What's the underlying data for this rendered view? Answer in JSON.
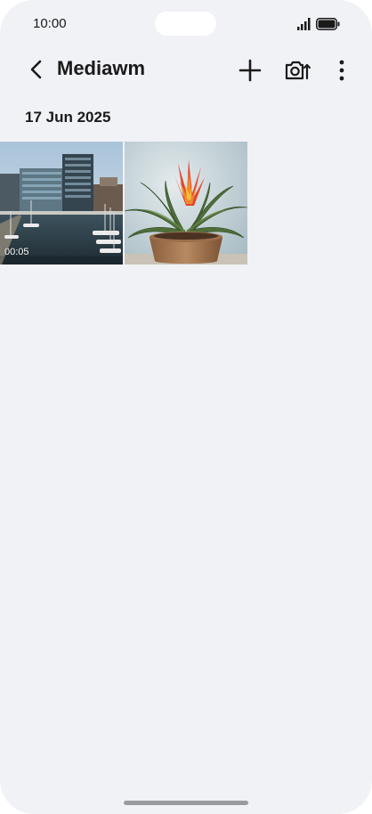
{
  "status_bar": {
    "time": "10:00",
    "icons": [
      "signal-icon",
      "battery-icon"
    ]
  },
  "header": {
    "back_icon": "chevron-left-icon",
    "title": "Mediawm",
    "actions": [
      "add-icon",
      "camera-icon",
      "more-vertical-icon"
    ]
  },
  "gallery": {
    "date": "17 Jun 2025",
    "items": [
      {
        "type": "video",
        "subject": "harbor-buildings",
        "duration": "00:05"
      },
      {
        "type": "image",
        "subject": "potted-bromeliad"
      }
    ]
  },
  "colors": {
    "background": "#f1f2f6",
    "text": "#1a1a1a",
    "home_indicator": "#9a9ba0"
  }
}
